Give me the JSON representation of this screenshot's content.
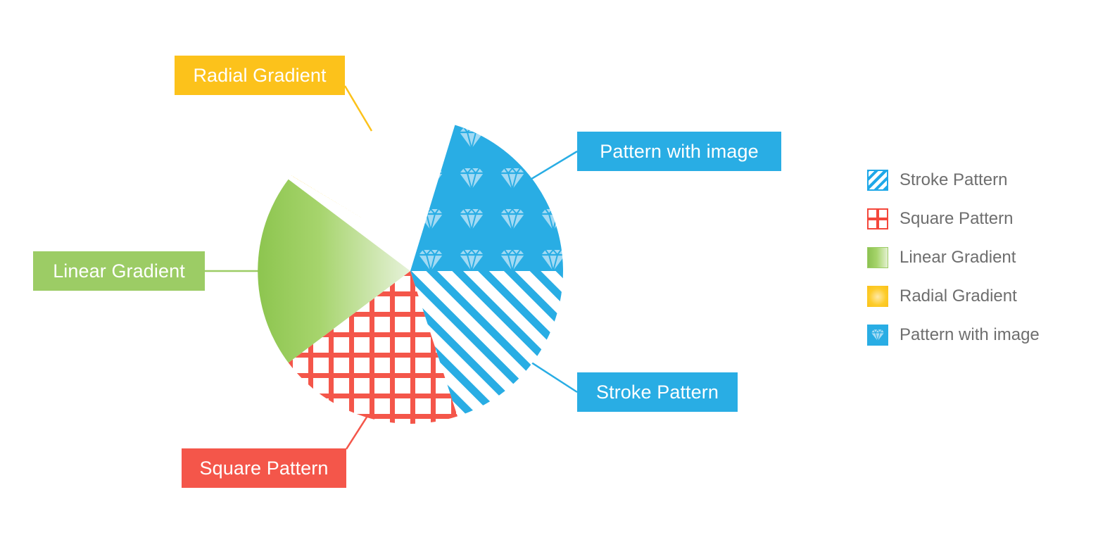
{
  "chart_data": {
    "type": "pie",
    "title": "",
    "categories": [
      "Pattern with image",
      "Stroke Pattern",
      "Square Pattern",
      "Linear Gradient",
      "Radial Gradient"
    ],
    "values": [
      25,
      25,
      20,
      15,
      15
    ],
    "legend_position": "right",
    "grid": false,
    "slices": [
      {
        "label": "Pattern with image",
        "value": 25,
        "start_angle_deg": 17,
        "end_angle_deg": 90,
        "fill_style": "pattern-image",
        "color": "#29ade4",
        "pattern_glyph": "diamond"
      },
      {
        "label": "Stroke Pattern",
        "value": 25,
        "start_angle_deg": 90,
        "end_angle_deg": 162,
        "fill_style": "diagonal-stripes",
        "color": "#29ade4"
      },
      {
        "label": "Square Pattern",
        "value": 20,
        "start_angle_deg": 162,
        "end_angle_deg": 233,
        "fill_style": "grid-squares",
        "color": "#f4564a"
      },
      {
        "label": "Linear Gradient",
        "value": 15,
        "start_angle_deg": 233,
        "end_angle_deg": 297,
        "fill_style": "linear-gradient",
        "color": "#9ccc65"
      },
      {
        "label": "Radial Gradient",
        "value": 15,
        "start_angle_deg": 297,
        "end_angle_deg": 377,
        "fill_style": "radial-gradient",
        "color": "#fbc02d"
      }
    ]
  },
  "colors": {
    "blue": "#29ade4",
    "red": "#f4564a",
    "green": "#9ccc65",
    "yellow": "#fbc02d",
    "legend_text": "#6e6e6e",
    "label_text": "#ffffff",
    "background": "#ffffff"
  },
  "callouts": [
    {
      "id": "radial-gradient",
      "text": "Radial Gradient",
      "color": "#fcc21b"
    },
    {
      "id": "pattern-image",
      "text": "Pattern with image",
      "color": "#29ade4"
    },
    {
      "id": "linear-gradient",
      "text": "Linear Gradient",
      "color": "#9ccc65"
    },
    {
      "id": "stroke-pattern",
      "text": "Stroke Pattern",
      "color": "#29ade4"
    },
    {
      "id": "square-pattern",
      "text": "Square Pattern",
      "color": "#f4564a"
    }
  ],
  "legend": {
    "items": [
      {
        "label": "Stroke Pattern",
        "swatch": "stroke-pattern-swatch",
        "color": "#1fa8e8"
      },
      {
        "label": "Square Pattern",
        "swatch": "square-pattern-swatch",
        "color": "#f4473b"
      },
      {
        "label": "Linear Gradient",
        "swatch": "linear-gradient-swatch",
        "color": "#9ccc65"
      },
      {
        "label": "Radial Gradient",
        "swatch": "radial-gradient-swatch",
        "color": "#fbc02d"
      },
      {
        "label": "Pattern with image",
        "swatch": "image-pattern-swatch",
        "color": "#29ade4"
      }
    ]
  }
}
